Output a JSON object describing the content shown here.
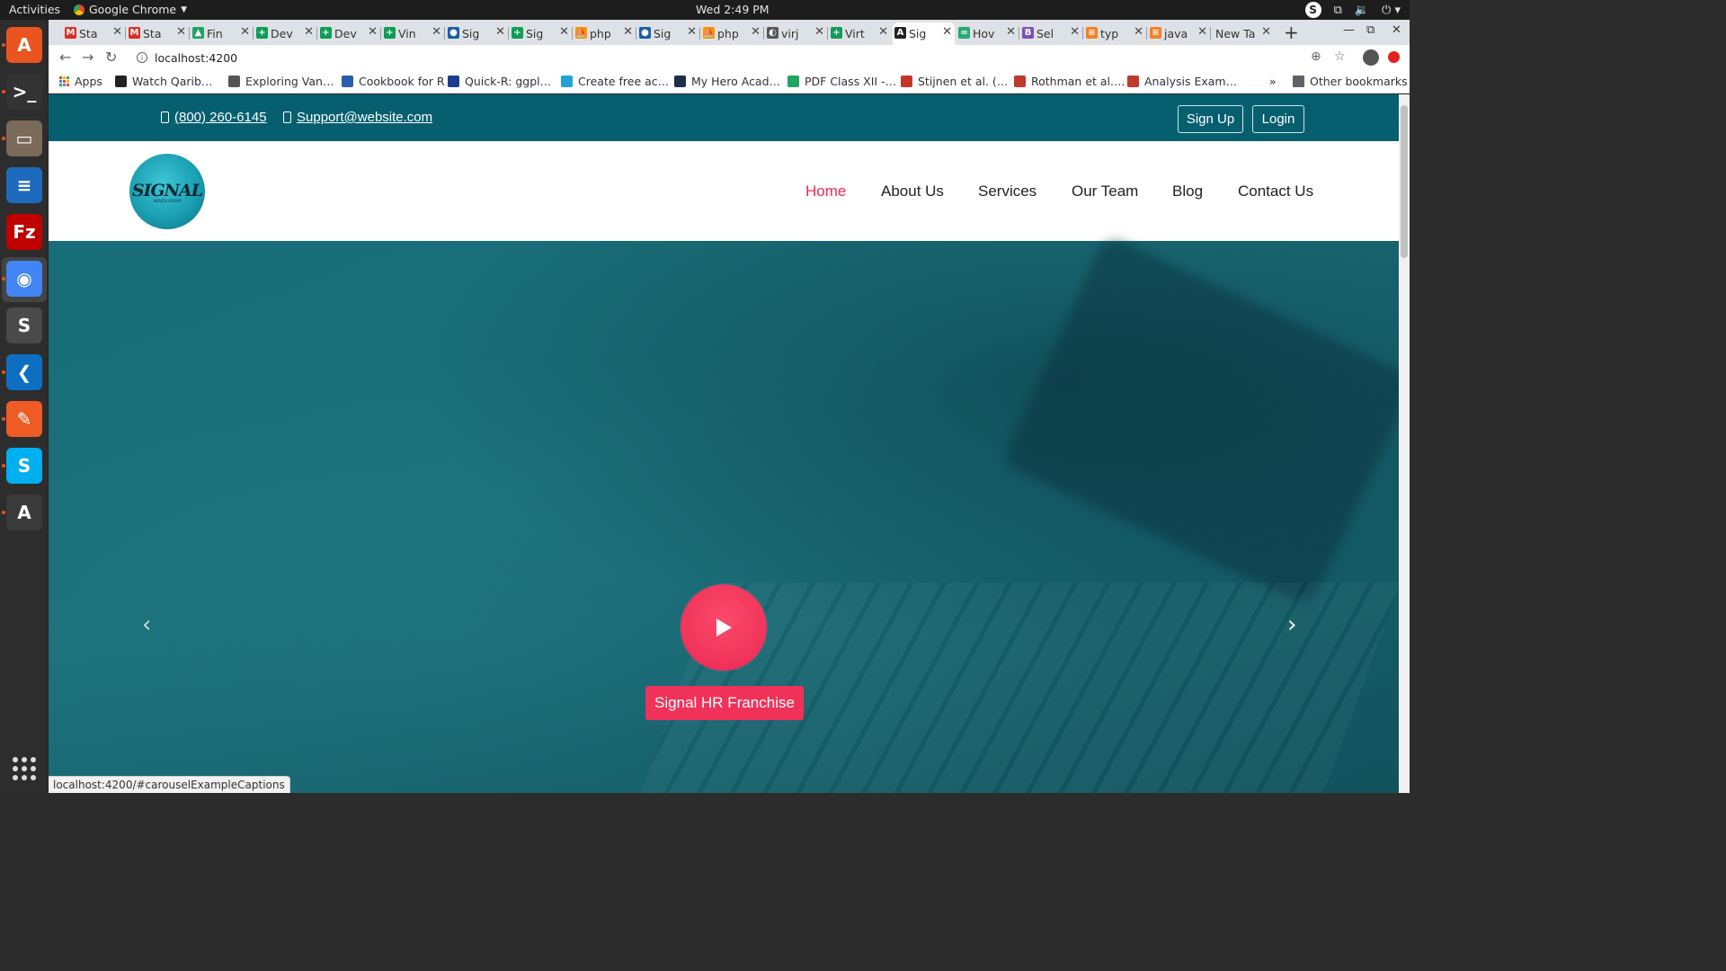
{
  "topbar": {
    "activities": "Activities",
    "app_name": "Google Chrome",
    "clock": "Wed  2:49 PM",
    "tray_badge": "S"
  },
  "dock": {
    "items": [
      {
        "name": "ubuntu-software-icon",
        "color": "#e95420",
        "glyph": "A"
      },
      {
        "name": "terminal-icon",
        "color": "#333333",
        "glyph": ">_"
      },
      {
        "name": "files-icon",
        "color": "#7a6a5a",
        "glyph": "▭"
      },
      {
        "name": "writer-icon",
        "color": "#1e6bbd",
        "glyph": "≡"
      },
      {
        "name": "filezilla-icon",
        "color": "#bf0000",
        "glyph": "Fz"
      },
      {
        "name": "chrome-icon",
        "color": "#4285f4",
        "glyph": "◉"
      },
      {
        "name": "sublime-icon",
        "color": "#4a4a4a",
        "glyph": "S"
      },
      {
        "name": "vscode-icon",
        "color": "#0e6fc2",
        "glyph": "❮"
      },
      {
        "name": "postman-icon",
        "color": "#ef5b25",
        "glyph": "✎"
      },
      {
        "name": "skype-icon",
        "color": "#00aff0",
        "glyph": "S"
      },
      {
        "name": "updater-icon",
        "color": "#3a3a3a",
        "glyph": "A"
      }
    ]
  },
  "tabs": [
    {
      "label": "Sta",
      "icon": "gmail-icon",
      "color": "#d93025",
      "glyph": "M"
    },
    {
      "label": "Sta",
      "icon": "gmail-icon",
      "color": "#d93025",
      "glyph": "M"
    },
    {
      "label": "Fin",
      "icon": "drive-icon",
      "color": "#1fa463",
      "glyph": "▲"
    },
    {
      "label": "Dev",
      "icon": "sheets-icon",
      "color": "#0f9d58",
      "glyph": "+"
    },
    {
      "label": "Dev",
      "icon": "sheets-icon",
      "color": "#0f9d58",
      "glyph": "+"
    },
    {
      "label": "Vin",
      "icon": "sheets-icon",
      "color": "#0f9d58",
      "glyph": "+"
    },
    {
      "label": "Sig",
      "icon": "circle-icon",
      "color": "#1a5fa6",
      "glyph": "●"
    },
    {
      "label": "Sig",
      "icon": "sheets-icon",
      "color": "#0f9d58",
      "glyph": "+"
    },
    {
      "label": "php",
      "icon": "pma-icon",
      "color": "#f89406",
      "glyph": "⛵"
    },
    {
      "label": "Sig",
      "icon": "circle-icon",
      "color": "#1a5fa6",
      "glyph": "●"
    },
    {
      "label": "php",
      "icon": "pma-icon",
      "color": "#f89406",
      "glyph": "⛵"
    },
    {
      "label": "virj",
      "icon": "globe-icon",
      "color": "#555555",
      "glyph": "◐"
    },
    {
      "label": "Virt",
      "icon": "sheets-icon",
      "color": "#0f9d58",
      "glyph": "+"
    },
    {
      "label": "Sig",
      "icon": "angular-icon",
      "color": "#222222",
      "glyph": "A",
      "active": true
    },
    {
      "label": "Hov",
      "icon": "link-icon",
      "color": "#2aa876",
      "glyph": "∞"
    },
    {
      "label": "Sel",
      "icon": "bootstrap-icon",
      "color": "#7952b3",
      "glyph": "B"
    },
    {
      "label": "typ",
      "icon": "stackoverflow-icon",
      "color": "#f48024",
      "glyph": "≋"
    },
    {
      "label": "java",
      "icon": "stackoverflow-icon",
      "color": "#f48024",
      "glyph": "≋"
    },
    {
      "label": "New Ta",
      "icon": "",
      "color": "",
      "glyph": ""
    }
  ],
  "toolbar": {
    "url": "localhost:4200"
  },
  "bookmarks": {
    "apps": "Apps",
    "items": [
      {
        "label": "Watch Qarib…",
        "color": "#222222"
      },
      {
        "label": "Exploring Van…",
        "color": "#555555"
      },
      {
        "label": "Cookbook for R",
        "color": "#2a5db0"
      },
      {
        "label": "Quick-R: ggpl…",
        "color": "#1a3d8f"
      },
      {
        "label": "Create free ac…",
        "color": "#1fa2d6"
      },
      {
        "label": "My Hero Acad…",
        "color": "#1c2e4a"
      },
      {
        "label": "PDF Class XII -…",
        "color": "#1fa463"
      },
      {
        "label": "Stijnen et al. (…",
        "color": "#c0392b"
      },
      {
        "label": "Rothman et al.…",
        "color": "#c0392b"
      },
      {
        "label": "Analysis Exam…",
        "color": "#c0392b"
      }
    ],
    "more": "»",
    "other": "Other bookmarks"
  },
  "site": {
    "phone": "(800) 260-6145",
    "email": "Support@website.com",
    "signup": "Sign Up",
    "login": "Login",
    "logo_text": "SIGNAL",
    "logo_sub": "HEALTH GROUP",
    "menu": {
      "home": "Home",
      "about": "About Us",
      "services": "Services",
      "team": "Our Team",
      "blog": "Blog",
      "contact": "Contact Us"
    },
    "hero_button": "Signal HR Franchise",
    "prev_arrow": "‹",
    "next_arrow": "›"
  },
  "statusbar": {
    "text": "localhost:4200/#carouselExampleCaptions"
  },
  "colors": {
    "brand_teal": "#065f6e",
    "accent_pink": "#f0325a",
    "nav_active": "#ea2a53"
  }
}
